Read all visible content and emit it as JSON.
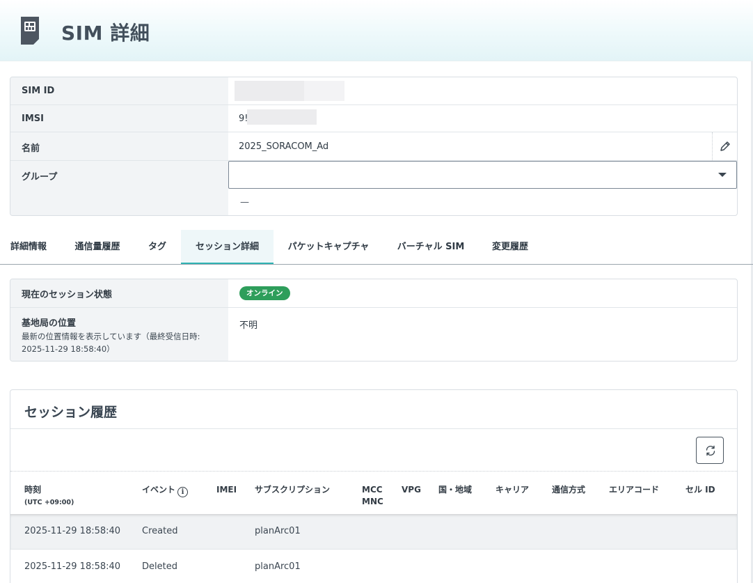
{
  "header": {
    "title": "SIM 詳細",
    "icon": "sim-card-icon"
  },
  "info": {
    "rows": [
      {
        "label": "SIM ID",
        "value": ""
      },
      {
        "label": "IMSI",
        "value": "9!"
      },
      {
        "label": "名前",
        "value": "2025_SORACOM_Ad"
      },
      {
        "label": "グループ",
        "value": "—"
      }
    ],
    "group_select_value": ""
  },
  "tabs": [
    {
      "label": "詳細情報",
      "active": false
    },
    {
      "label": "通信量履歴",
      "active": false
    },
    {
      "label": "タグ",
      "active": false
    },
    {
      "label": "セッション詳細",
      "active": true
    },
    {
      "label": "パケットキャプチャ",
      "active": false
    },
    {
      "label": "バーチャル SIM",
      "active": false
    },
    {
      "label": "変更履歴",
      "active": false
    }
  ],
  "session_status": {
    "state_label": "現在のセッション状態",
    "state_badge": "オンライン",
    "location_label": "基地局の位置",
    "location_sub": "最新の位置情報を表示しています（最終受信日時:",
    "location_sub_time": "2025-11-29 18:58:40）",
    "location_value": "不明"
  },
  "history": {
    "title": "セッション履歴",
    "columns": {
      "time": "時刻",
      "time_tz": "(UTC +09:00)",
      "event": "イベント",
      "imei": "IMEI",
      "subscription": "サブスクリプション",
      "mcc": "MCC",
      "mnc": "MNC",
      "vpg": "VPG",
      "country": "国・地域",
      "carrier": "キャリア",
      "rat": "通信方式",
      "area_code": "エリアコード",
      "cell_id": "セル ID"
    },
    "rows": [
      {
        "time": "2025-11-29 18:58:40",
        "event": "Created",
        "subscription": "planArc01"
      },
      {
        "time": "2025-11-29 18:58:40",
        "event": "Deleted",
        "subscription": "planArc01"
      }
    ]
  },
  "colors": {
    "accent": "#2fb3b3",
    "online_badge": "#2e9e5b",
    "label_bg": "#f2f4f6"
  }
}
